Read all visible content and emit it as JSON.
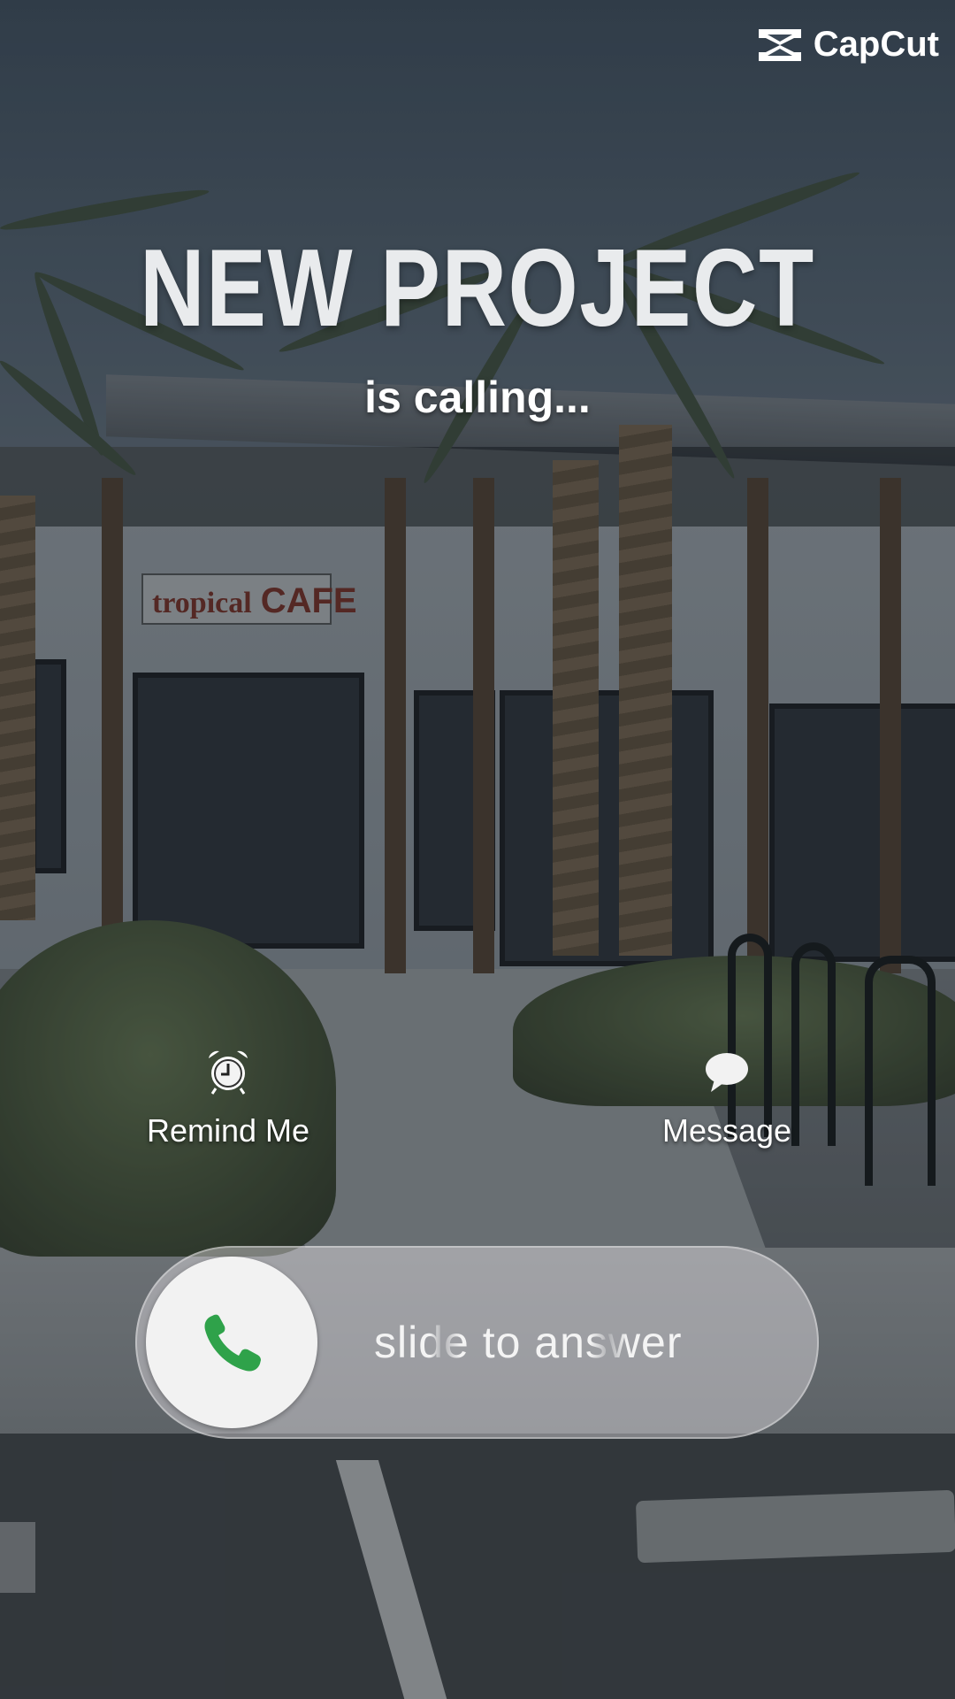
{
  "brand": {
    "name": "CapCut",
    "icon": "capcut-logo-icon"
  },
  "call": {
    "caller": "NEW PROJECT",
    "status": "is calling..."
  },
  "actions": [
    {
      "label": "Remind Me",
      "icon": "alarm-clock-icon"
    },
    {
      "label": "Message",
      "icon": "speech-bubble-icon"
    }
  ],
  "answer": {
    "label": "slide to answer",
    "icon": "phone-icon",
    "icon_color": "#2fa24a"
  },
  "background": {
    "sign_text_1": "tropical",
    "sign_text_2": "CAFE"
  }
}
